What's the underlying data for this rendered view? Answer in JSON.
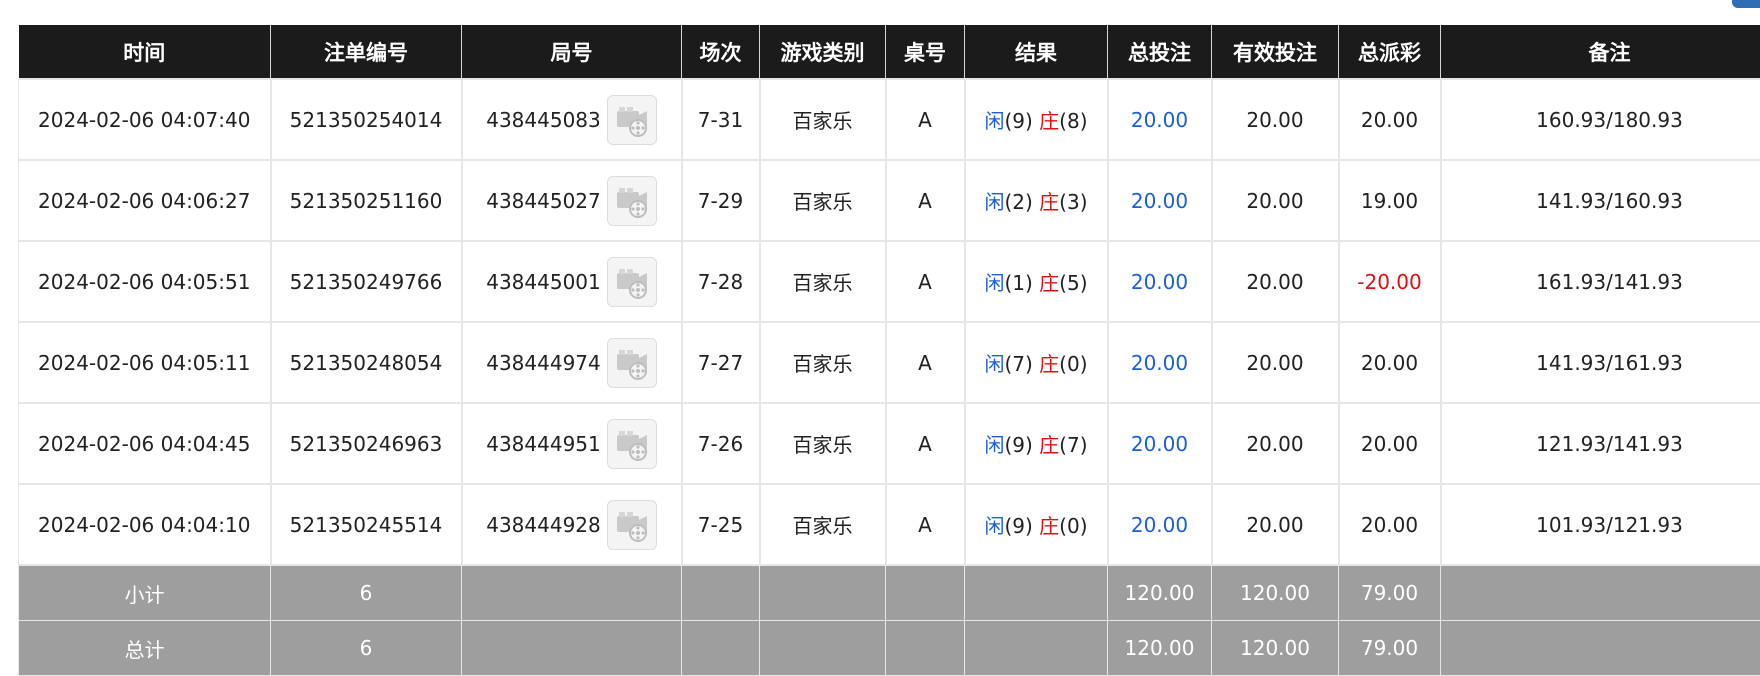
{
  "headers": [
    "时间",
    "注单编号",
    "局号",
    "场次",
    "游戏类别",
    "桌号",
    "结果",
    "总投注",
    "有效投注",
    "总派彩",
    "备注"
  ],
  "rows": [
    {
      "time": "2024-02-06 04:07:40",
      "bet_no": "521350254014",
      "round": "438445083",
      "session": "7-31",
      "game": "百家乐",
      "table": "A",
      "player_label": "闲",
      "player_score": "(9)",
      "banker_label": "庄",
      "banker_score": "(8)",
      "total_bet": "20.00",
      "valid_bet": "20.00",
      "payout": "20.00",
      "payout_negative": false,
      "note": "160.93/180.93"
    },
    {
      "time": "2024-02-06 04:06:27",
      "bet_no": "521350251160",
      "round": "438445027",
      "session": "7-29",
      "game": "百家乐",
      "table": "A",
      "player_label": "闲",
      "player_score": "(2)",
      "banker_label": "庄",
      "banker_score": "(3)",
      "total_bet": "20.00",
      "valid_bet": "20.00",
      "payout": "19.00",
      "payout_negative": false,
      "note": "141.93/160.93"
    },
    {
      "time": "2024-02-06 04:05:51",
      "bet_no": "521350249766",
      "round": "438445001",
      "session": "7-28",
      "game": "百家乐",
      "table": "A",
      "player_label": "闲",
      "player_score": "(1)",
      "banker_label": "庄",
      "banker_score": "(5)",
      "total_bet": "20.00",
      "valid_bet": "20.00",
      "payout": "-20.00",
      "payout_negative": true,
      "note": "161.93/141.93"
    },
    {
      "time": "2024-02-06 04:05:11",
      "bet_no": "521350248054",
      "round": "438444974",
      "session": "7-27",
      "game": "百家乐",
      "table": "A",
      "player_label": "闲",
      "player_score": "(7)",
      "banker_label": "庄",
      "banker_score": "(0)",
      "total_bet": "20.00",
      "valid_bet": "20.00",
      "payout": "20.00",
      "payout_negative": false,
      "note": "141.93/161.93"
    },
    {
      "time": "2024-02-06 04:04:45",
      "bet_no": "521350246963",
      "round": "438444951",
      "session": "7-26",
      "game": "百家乐",
      "table": "A",
      "player_label": "闲",
      "player_score": "(9)",
      "banker_label": "庄",
      "banker_score": "(7)",
      "total_bet": "20.00",
      "valid_bet": "20.00",
      "payout": "20.00",
      "payout_negative": false,
      "note": "121.93/141.93"
    },
    {
      "time": "2024-02-06 04:04:10",
      "bet_no": "521350245514",
      "round": "438444928",
      "session": "7-25",
      "game": "百家乐",
      "table": "A",
      "player_label": "闲",
      "player_score": "(9)",
      "banker_label": "庄",
      "banker_score": "(0)",
      "total_bet": "20.00",
      "valid_bet": "20.00",
      "payout": "20.00",
      "payout_negative": false,
      "note": "101.93/121.93"
    }
  ],
  "subtotal": {
    "label": "小计",
    "count": "6",
    "total_bet": "120.00",
    "valid_bet": "120.00",
    "payout": "79.00"
  },
  "total": {
    "label": "总计",
    "count": "6",
    "total_bet": "120.00",
    "valid_bet": "120.00",
    "payout": "79.00"
  },
  "icons": {
    "replay": "video-replay-icon"
  },
  "colors": {
    "header_bg": "#1b1b1b",
    "summary_bg": "#9e9e9e",
    "accent_blue": "#1d5fd6",
    "negative_red": "#e01010",
    "corner_badge": "#2f6db4"
  }
}
